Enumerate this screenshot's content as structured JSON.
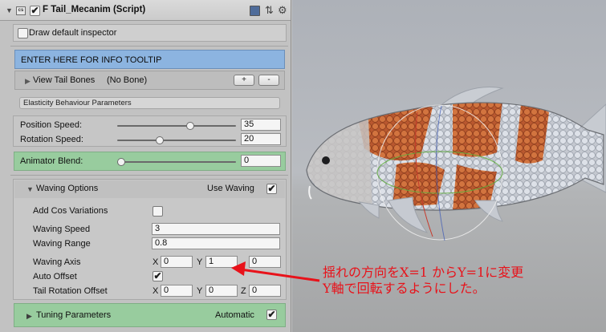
{
  "component": {
    "title": "F Tail_Mecanim (Script)",
    "script_icon_text": "cs",
    "enabled": true,
    "icons": [
      "fold-arrow-icon",
      "script-icon",
      "reference-book-icon",
      "settings-gear-icon"
    ]
  },
  "draw_default": {
    "label": "Draw default inspector",
    "checked": false
  },
  "info": {
    "label": "ENTER HERE FOR INFO TOOLTIP"
  },
  "tail_bones": {
    "label": "View Tail Bones",
    "value": "(No Bone)",
    "add": "+",
    "remove": "-"
  },
  "section_label": "Elasticity Behaviour Parameters",
  "position_speed": {
    "label": "Position Speed:",
    "value": "35",
    "fraction": 0.62
  },
  "rotation_speed": {
    "label": "Rotation Speed:",
    "value": "20",
    "fraction": 0.35
  },
  "animator_blend": {
    "label": "Animator Blend:",
    "value": "0",
    "fraction": 0.0
  },
  "waving": {
    "title": "Waving Options",
    "use_label": "Use Waving",
    "use_checked": true,
    "cos_label": "Add Cos Variations",
    "cos_checked": false,
    "speed_label": "Waving Speed",
    "speed_value": "3",
    "range_label": "Waving Range",
    "range_value": "0.8",
    "axis_label": "Waving Axis",
    "axis": {
      "x_label": "X",
      "x": "0",
      "y_label": "Y",
      "y": "1",
      "z": "0"
    },
    "auto_offset_label": "Auto Offset",
    "auto_offset_checked": true,
    "tail_rot_label": "Tail Rotation Offset",
    "tail_rot": {
      "x_label": "X",
      "x": "0",
      "y_label": "Y",
      "y": "0",
      "z_label": "Z",
      "z": "0"
    }
  },
  "tuning": {
    "label": "Tuning Parameters",
    "auto_label": "Automatic",
    "auto_checked": true
  },
  "annotation": {
    "line1": "揺れの方向をX=1 からY=1に変更",
    "line2": "Y軸で回転するようにした。",
    "color": "#e8121a"
  },
  "colors": {
    "info_bar": "#8cb4e0",
    "green_bar": "#98cc9e",
    "koi_orange": "#c8643a",
    "koi_white": "#d9dde3"
  }
}
